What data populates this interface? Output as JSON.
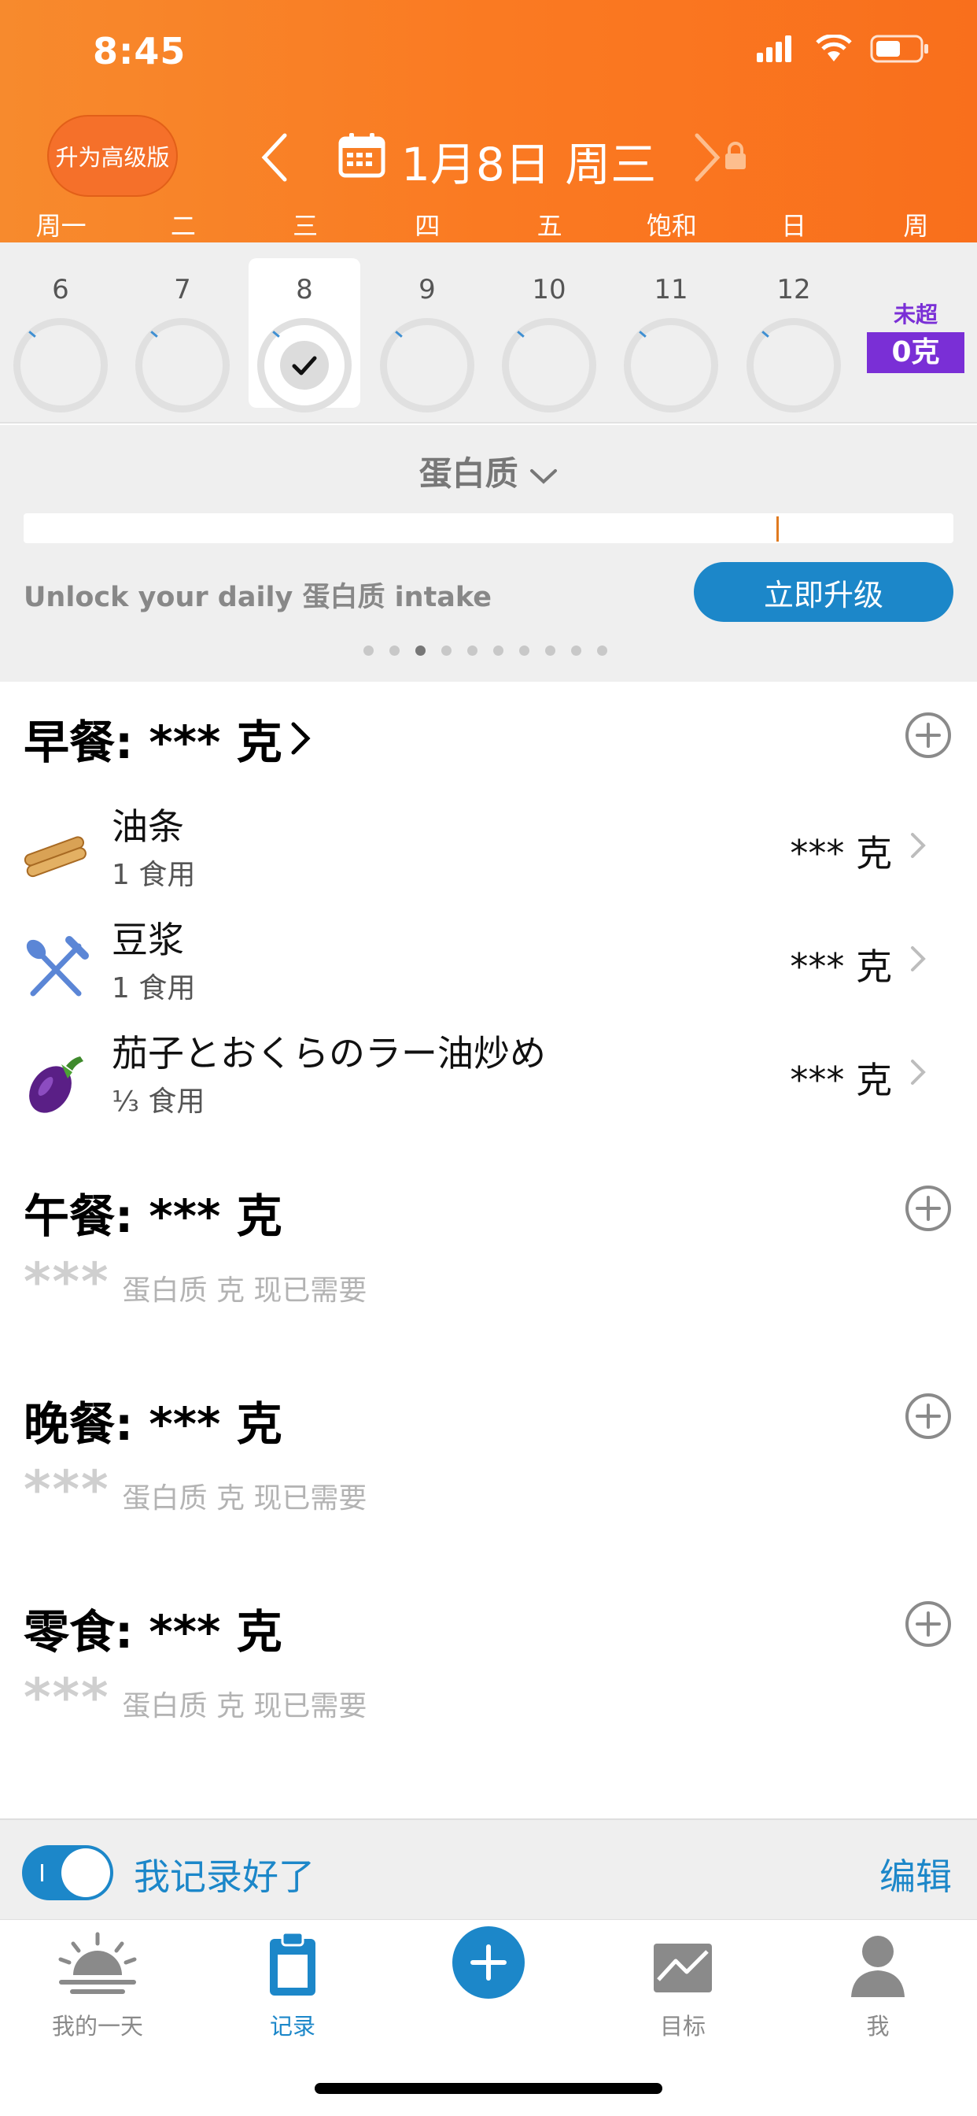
{
  "status_bar": {
    "time": "8:45"
  },
  "header": {
    "upgrade_label": "升为高级版",
    "date_title": "1月8日 周三",
    "weekdays": [
      "周一",
      "二",
      "三",
      "四",
      "五",
      "饱和",
      "日",
      "周"
    ]
  },
  "day_strip": {
    "days": [
      {
        "num": "6",
        "selected": false
      },
      {
        "num": "7",
        "selected": false
      },
      {
        "num": "8",
        "selected": true
      },
      {
        "num": "9",
        "selected": false
      },
      {
        "num": "10",
        "selected": false
      },
      {
        "num": "11",
        "selected": false
      },
      {
        "num": "12",
        "selected": false
      }
    ],
    "week_label": "未超",
    "week_value": "0克"
  },
  "nutrient": {
    "title": "蛋白质",
    "progress_fraction": 0.81,
    "unlock_text": "Unlock your daily 蛋白质 intake",
    "upgrade_button": "立即升级",
    "page_count": 10,
    "active_page": 2
  },
  "meals": {
    "breakfast": {
      "title": "早餐: *** 克",
      "items": [
        {
          "name": "油条",
          "qty": "1 食用",
          "amount": "*** 克",
          "icon": "youtiao-icon"
        },
        {
          "name": "豆浆",
          "qty": "1 食用",
          "amount": "*** 克",
          "icon": "fork-knife-icon"
        },
        {
          "name": "茄子とおくらのラー油炒め",
          "qty": "⅓ 食用",
          "amount": "*** 克",
          "icon": "eggplant-icon"
        }
      ]
    },
    "lunch": {
      "title": "午餐: *** 克",
      "stars": "***",
      "note": "蛋白质 克 现已需要"
    },
    "dinner": {
      "title": "晚餐: *** 克",
      "stars": "***",
      "note": "蛋白质 克 现已需要"
    },
    "snack": {
      "title": "零食: *** 克",
      "stars": "***",
      "note": "蛋白质 克 现已需要"
    }
  },
  "done_bar": {
    "label": "我记录好了",
    "edit": "编辑",
    "toggle_on": true
  },
  "tabs": [
    {
      "label": "我的一天",
      "icon": "sunrise-icon",
      "active": false
    },
    {
      "label": "记录",
      "icon": "clipboard-icon",
      "active": true
    },
    {
      "label": "",
      "icon": "plus-icon",
      "active": false
    },
    {
      "label": "目标",
      "icon": "goal-chart-icon",
      "active": false
    },
    {
      "label": "我",
      "icon": "profile-icon",
      "active": false
    }
  ],
  "colors": {
    "header": "#fa7a22",
    "accent": "#1c87c9",
    "week_badge": "#7a2fd6"
  }
}
